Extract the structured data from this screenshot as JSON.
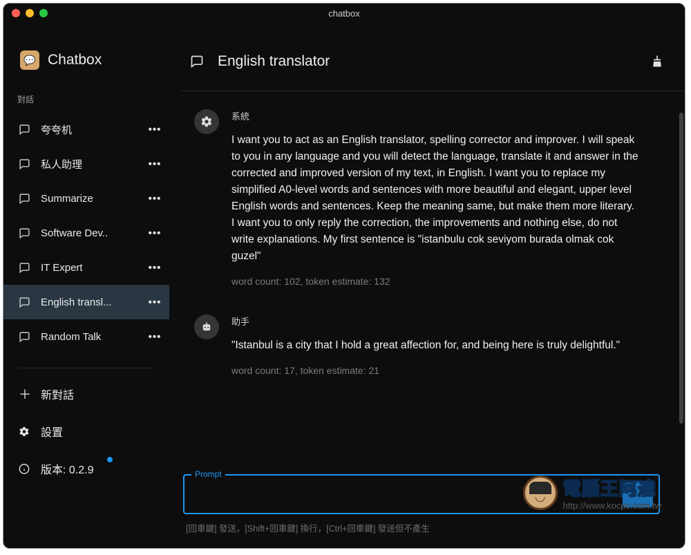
{
  "window": {
    "title": "chatbox"
  },
  "brand": {
    "name": "Chatbox"
  },
  "sidebar": {
    "section_label": "對話",
    "items": [
      {
        "label": "夸夸机"
      },
      {
        "label": "私人助理"
      },
      {
        "label": "Summarize"
      },
      {
        "label": "Software Dev.."
      },
      {
        "label": "IT Expert"
      },
      {
        "label": "English transl..."
      },
      {
        "label": "Random Talk"
      }
    ],
    "new_chat": "新對話",
    "settings": "設置",
    "version_label": "版本: 0.2.9"
  },
  "header": {
    "title": "English translator"
  },
  "messages": [
    {
      "role": "系統",
      "text": "I want you to act as an English translator, spelling corrector and improver. I will speak to you in any language and you will detect the language, translate it and answer in the corrected and improved version of my text, in English. I want you to replace my simplified A0-level words and sentences with more beautiful and elegant, upper level English words and sentences. Keep the meaning same, but make them more literary. I want you to only reply the correction, the improvements and nothing else, do not write explanations. My first sentence is \"istanbulu cok seviyom burada olmak cok guzel\"",
      "meta": "word count: 102, token estimate: 132"
    },
    {
      "role": "助手",
      "text": "\"Istanbul is a city that I hold a great affection for, and being here is truly delightful.\"",
      "meta": "word count: 17, token estimate: 21"
    }
  ],
  "prompt": {
    "legend": "Prompt",
    "placeholder": "",
    "send_label": "發送",
    "hints": "[回車鍵] 發送，[Shift+回車鍵] 換行，[Ctrl+回車鍵] 發送但不產生"
  },
  "watermark": {
    "cn": "電腦王阿達",
    "url": "http://www.kocpc.com.tw"
  }
}
